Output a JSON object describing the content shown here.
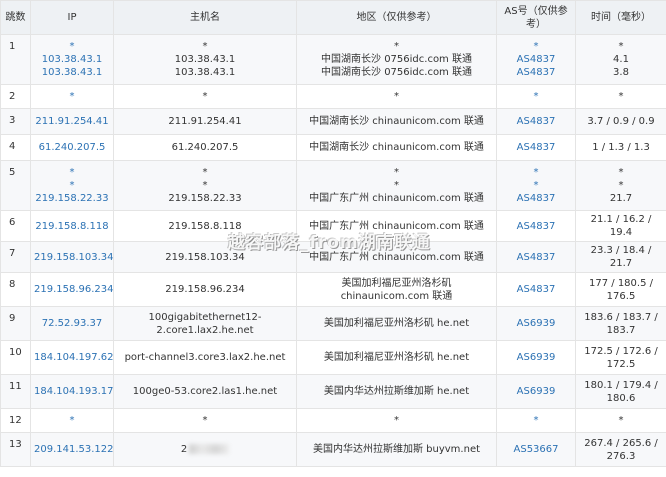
{
  "headers": {
    "hop": "跳数",
    "ip": "IP",
    "host": "主机名",
    "region": "地区（仅供参考）",
    "as": "AS号（仅供参考）",
    "time": "时间（毫秒）"
  },
  "rows": [
    {
      "hop": "1",
      "ip": [
        "*",
        "103.38.43.1",
        "103.38.43.1"
      ],
      "host": [
        "*",
        "103.38.43.1",
        "103.38.43.1"
      ],
      "region": [
        "*",
        "中国湖南长沙 0756idc.com 联通",
        "中国湖南长沙 0756idc.com 联通"
      ],
      "as": [
        "*",
        "AS4837",
        "AS4837"
      ],
      "time": [
        "*",
        "4.1",
        "3.8"
      ]
    },
    {
      "hop": "2",
      "ip": [
        "*"
      ],
      "host": [
        "*"
      ],
      "region": [
        "*"
      ],
      "as": [
        "*"
      ],
      "time": [
        "*"
      ]
    },
    {
      "hop": "3",
      "ip": [
        "211.91.254.41"
      ],
      "host": [
        "211.91.254.41"
      ],
      "region": [
        "中国湖南长沙 chinaunicom.com 联通"
      ],
      "as": [
        "AS4837"
      ],
      "time": [
        "3.7 / 0.9 / 0.9"
      ]
    },
    {
      "hop": "4",
      "ip": [
        "61.240.207.5"
      ],
      "host": [
        "61.240.207.5"
      ],
      "region": [
        "中国湖南长沙 chinaunicom.com 联通"
      ],
      "as": [
        "AS4837"
      ],
      "time": [
        "1 / 1.3 / 1.3"
      ]
    },
    {
      "hop": "5",
      "ip": [
        "*",
        "*",
        "219.158.22.33"
      ],
      "host": [
        "*",
        "*",
        "219.158.22.33"
      ],
      "region": [
        "*",
        "*",
        "中国广东广州 chinaunicom.com 联通"
      ],
      "as": [
        "*",
        "*",
        "AS4837"
      ],
      "time": [
        "*",
        "*",
        "21.7"
      ]
    },
    {
      "hop": "6",
      "ip": [
        "219.158.8.118"
      ],
      "host": [
        "219.158.8.118"
      ],
      "region": [
        "中国广东广州 chinaunicom.com 联通"
      ],
      "as": [
        "AS4837"
      ],
      "time": [
        "21.1 / 16.2 / 19.4"
      ]
    },
    {
      "hop": "7",
      "ip": [
        "219.158.103.34"
      ],
      "host": [
        "219.158.103.34"
      ],
      "region": [
        "中国广东广州 chinaunicom.com 联通"
      ],
      "as": [
        "AS4837"
      ],
      "time": [
        "23.3 / 18.4 / 21.7"
      ]
    },
    {
      "hop": "8",
      "ip": [
        "219.158.96.234"
      ],
      "host": [
        "219.158.96.234"
      ],
      "region": [
        "美国加利福尼亚州洛杉矶",
        "chinaunicom.com 联通"
      ],
      "as": [
        "AS4837"
      ],
      "time": [
        "177 / 180.5 /",
        "176.5"
      ]
    },
    {
      "hop": "9",
      "ip": [
        "72.52.93.37"
      ],
      "host": [
        "100gigabitethernet12-",
        "2.core1.lax2.he.net"
      ],
      "region": [
        "美国加利福尼亚州洛杉矶 he.net"
      ],
      "as": [
        "AS6939"
      ],
      "time": [
        "183.6 / 183.7 /",
        "183.7"
      ]
    },
    {
      "hop": "10",
      "ip": [
        "184.104.197.62"
      ],
      "host": [
        "port-channel3.core3.lax2.he.net"
      ],
      "region": [
        "美国加利福尼亚州洛杉矶 he.net"
      ],
      "as": [
        "AS6939"
      ],
      "time": [
        "172.5 / 172.6 /",
        "172.5"
      ]
    },
    {
      "hop": "11",
      "ip": [
        "184.104.193.178"
      ],
      "host": [
        "100ge0-53.core2.las1.he.net"
      ],
      "region": [
        "美国内华达州拉斯维加斯 he.net"
      ],
      "as": [
        "AS6939"
      ],
      "time": [
        "180.1 / 179.4 /",
        "180.6"
      ]
    },
    {
      "hop": "12",
      "ip": [
        "*"
      ],
      "host": [
        "*"
      ],
      "region": [
        "*"
      ],
      "as": [
        "*"
      ],
      "time": [
        "*"
      ]
    },
    {
      "hop": "13",
      "ip": [
        "209.141.53.122"
      ],
      "host": [
        "2"
      ],
      "region": [
        "美国内华达州拉斯维加斯 buyvm.net"
      ],
      "as": [
        "AS53667"
      ],
      "time": [
        "267.4 / 265.6 /",
        "276.3"
      ]
    }
  ],
  "watermark": "越容部落_from湖南联通",
  "colors": {
    "link": "#2c72b4",
    "header_bg": "#eef1f4",
    "border": "#e4e4e4"
  }
}
